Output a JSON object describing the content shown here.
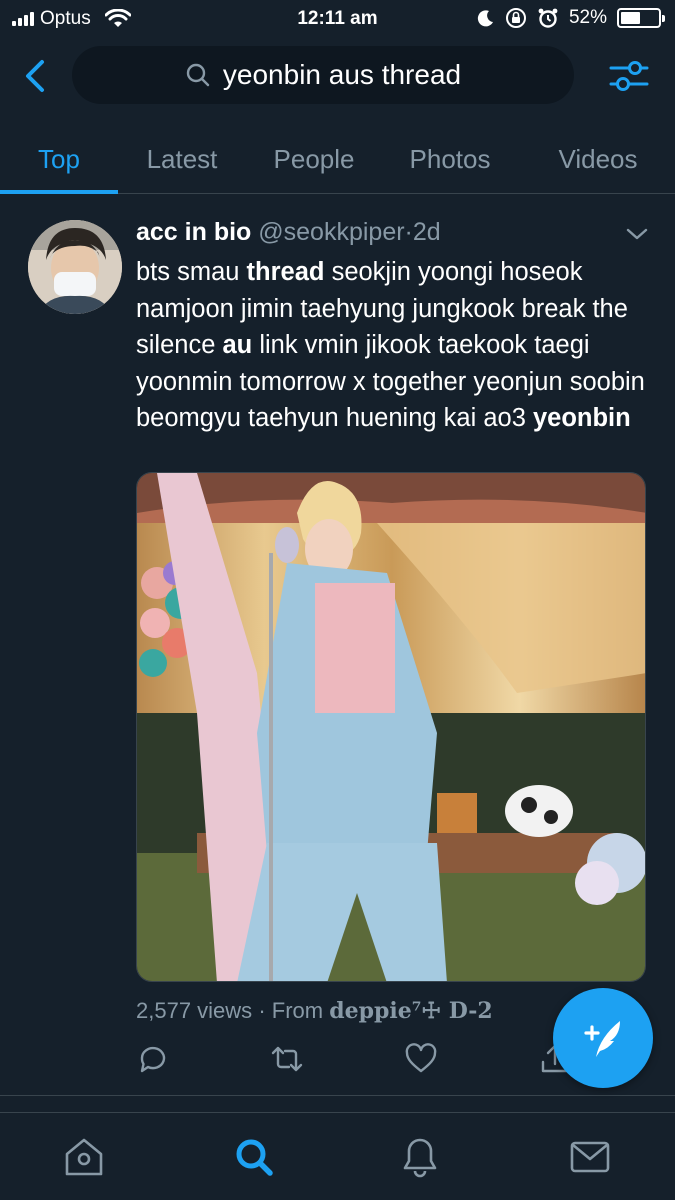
{
  "status_bar": {
    "carrier": "Optus",
    "time": "12:11 am",
    "battery": "52%",
    "battery_level": 0.52
  },
  "search": {
    "query": "yeonbin aus thread"
  },
  "tabs": [
    {
      "label": "Top",
      "active": true
    },
    {
      "label": "Latest",
      "active": false
    },
    {
      "label": "People",
      "active": false
    },
    {
      "label": "Photos",
      "active": false
    },
    {
      "label": "Videos",
      "active": false
    }
  ],
  "tweet": {
    "name": "acc in bio",
    "handle": "@seokkpiper",
    "separator": "·",
    "time": "2d",
    "text_segments": [
      {
        "t": "bts smau ",
        "b": false
      },
      {
        "t": "thread",
        "b": true
      },
      {
        "t": " seokjin yoongi hoseok namjoon jimin taehyung jungkook break the silence ",
        "b": false
      },
      {
        "t": "au",
        "b": true
      },
      {
        "t": " link vmin jikook taekook taegi yoonmin tomorrow x together yeonjun soobin beomgyu taehyun huening kai ao3 ",
        "b": false
      },
      {
        "t": "yeonbin",
        "b": true
      }
    ],
    "views": "2,577 views",
    "from_label": "· From",
    "source_app": "deppie⁷☩ D-2"
  },
  "colors": {
    "background": "#15202b",
    "accent": "#1da1f2",
    "secondary_text": "#8899a6",
    "divider": "#38444d"
  },
  "icons": [
    "back-arrow-icon",
    "search-icon",
    "filter-icon",
    "chevron-down-icon",
    "reply-icon",
    "retweet-icon",
    "like-icon",
    "share-icon",
    "compose-tweet-icon",
    "home-icon",
    "explore-icon",
    "notifications-icon",
    "messages-icon"
  ]
}
